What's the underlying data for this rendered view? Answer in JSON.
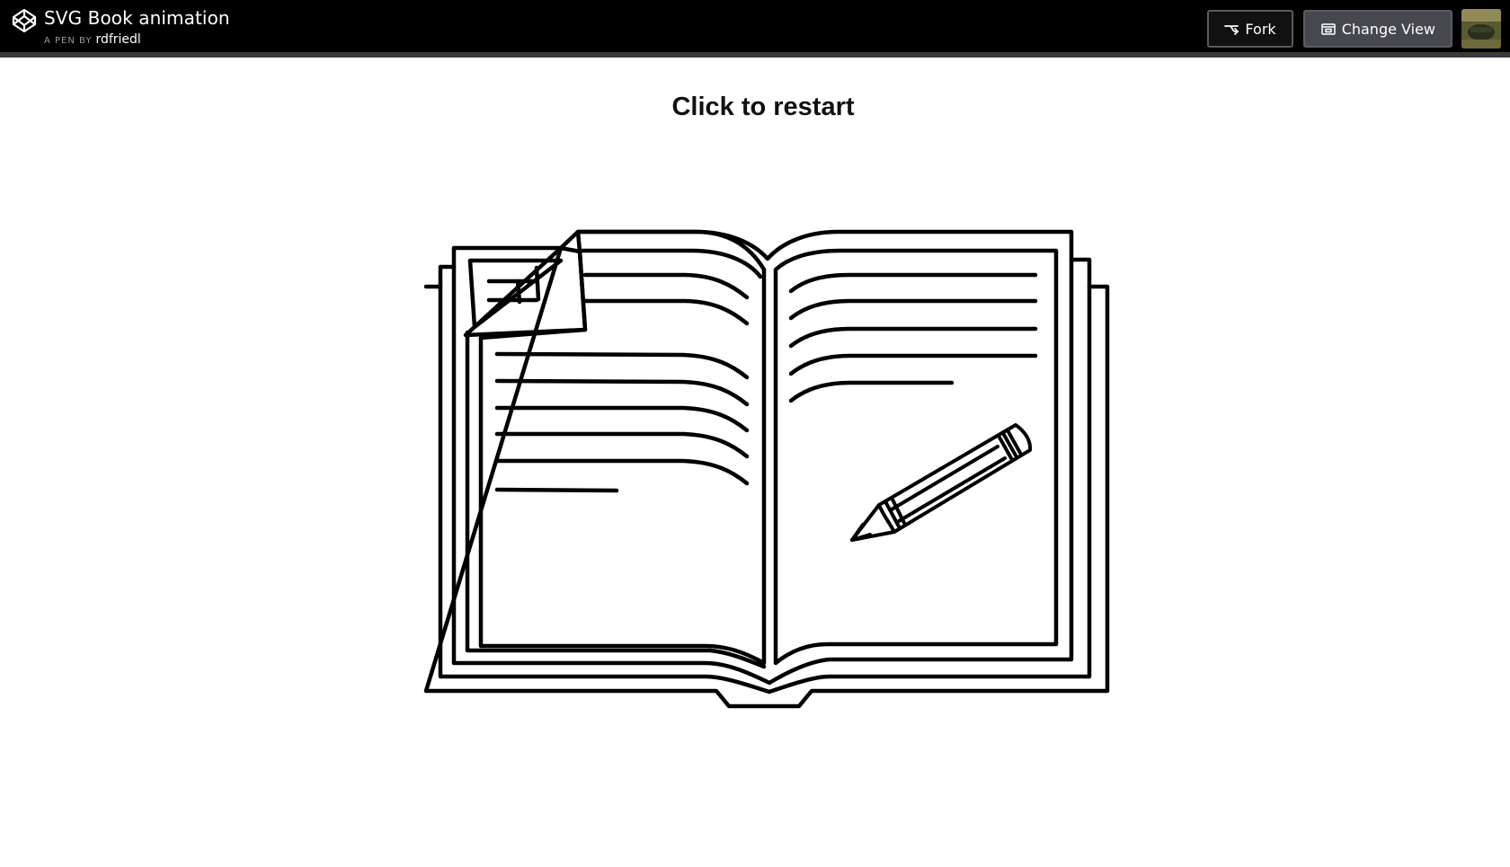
{
  "header": {
    "pen_title": "SVG Book animation",
    "byline_prefix": "A PEN BY",
    "author": "rdfriedl",
    "fork_label": "Fork",
    "change_view_label": "Change View"
  },
  "icons": {
    "logo": "codepen-logo-icon",
    "fork": "fork-icon",
    "change_view": "change-view-icon",
    "avatar": "user-avatar"
  },
  "main": {
    "restart_text": "Click to restart"
  },
  "colors": {
    "header_bg": "#000000",
    "header_border": "#3a3a3a",
    "change_view_bg": "#47484e",
    "stroke": "#000000",
    "page_bg": "#ffffff"
  }
}
